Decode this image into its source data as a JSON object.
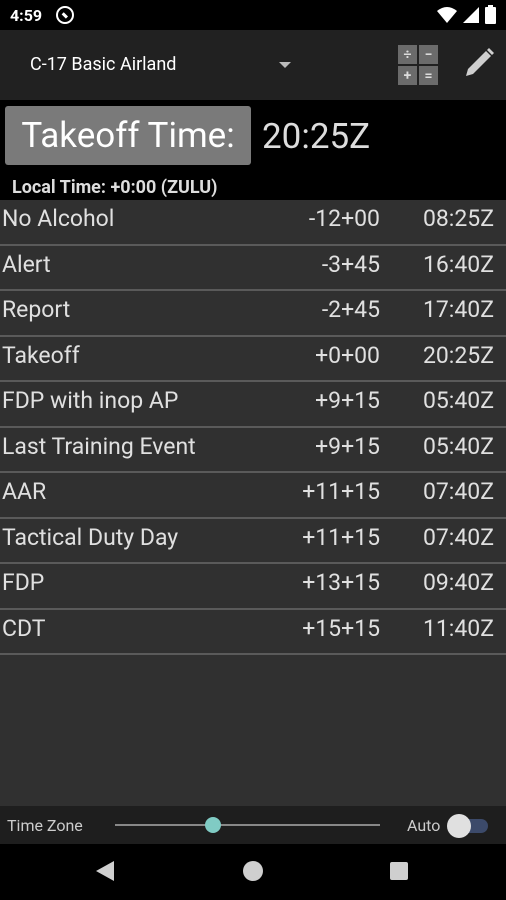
{
  "status": {
    "time": "4:59",
    "icons": [
      "do-not-disturb-icon",
      "wifi-icon",
      "cellular-icon",
      "battery-icon"
    ]
  },
  "toolbar": {
    "profile": "C-17 Basic Airland",
    "calc_icon": "calculator-icon",
    "edit_icon": "pencil-icon"
  },
  "takeoff": {
    "label": "Takeoff Time:",
    "value": "20:25Z"
  },
  "local_time": "Local Time: +0:00 (ZULU)",
  "events": [
    {
      "name": "No Alcohol",
      "offset": "-12+00",
      "time": "08:25Z"
    },
    {
      "name": "Alert",
      "offset": "-3+45",
      "time": "16:40Z"
    },
    {
      "name": "Report",
      "offset": "-2+45",
      "time": "17:40Z"
    },
    {
      "name": "Takeoff",
      "offset": "+0+00",
      "time": "20:25Z"
    },
    {
      "name": "FDP with inop AP",
      "offset": "+9+15",
      "time": "05:40Z"
    },
    {
      "name": "Last Training Event",
      "offset": "+9+15",
      "time": "05:40Z"
    },
    {
      "name": "AAR",
      "offset": "+11+15",
      "time": "07:40Z"
    },
    {
      "name": "Tactical Duty Day",
      "offset": "+11+15",
      "time": "07:40Z"
    },
    {
      "name": "FDP",
      "offset": "+13+15",
      "time": "09:40Z"
    },
    {
      "name": "CDT",
      "offset": "+15+15",
      "time": "11:40Z"
    }
  ],
  "timezone": {
    "label": "Time Zone",
    "auto_label": "Auto",
    "slider_level": 0.37,
    "auto_enabled": false
  },
  "colors": {
    "accent": "#80cbc4",
    "row_bg": "#303030",
    "toolbar_bg": "#212121"
  }
}
